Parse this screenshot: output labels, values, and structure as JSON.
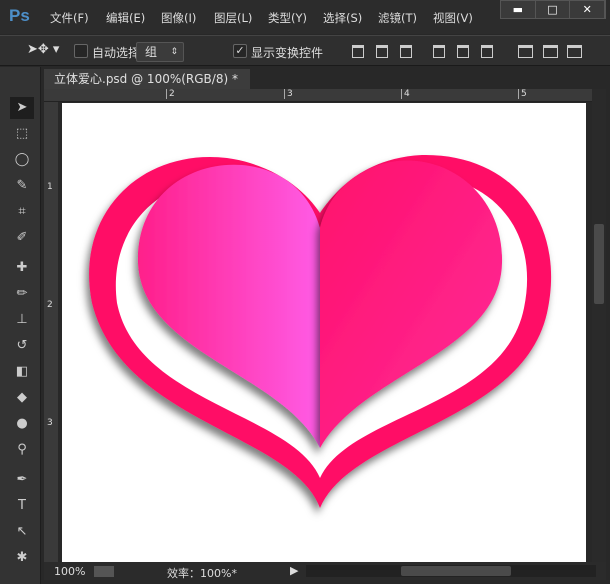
{
  "app": {
    "logo": "Ps"
  },
  "menu": [
    "文件(F)",
    "编辑(E)",
    "图像(I)",
    "图层(L)",
    "类型(Y)",
    "选择(S)",
    "滤镜(T)",
    "视图(V)"
  ],
  "window_buttons": {
    "minimize": "▬",
    "maximize": "□",
    "close": "✕"
  },
  "options": {
    "auto_select_label": "自动选择：",
    "auto_select_checked": false,
    "group_value": "组",
    "show_transform_label": "显示变换控件",
    "show_transform_checked": true,
    "check_mark": "✓",
    "select_arrows": "⇕"
  },
  "document": {
    "tab_title": "立体爱心.psd @ 100%(RGB/8) *",
    "close": "×"
  },
  "rulers": {
    "horizontal": [
      "2",
      "3",
      "4",
      "5"
    ],
    "vertical": [
      "1",
      "2",
      "3"
    ]
  },
  "status": {
    "zoom": "100%",
    "efficiency": "效率：100%*"
  },
  "heart": {
    "outer_color": "#ff0a66",
    "inner_left": "#ff5ce6",
    "inner_right": "#ff1a75"
  }
}
